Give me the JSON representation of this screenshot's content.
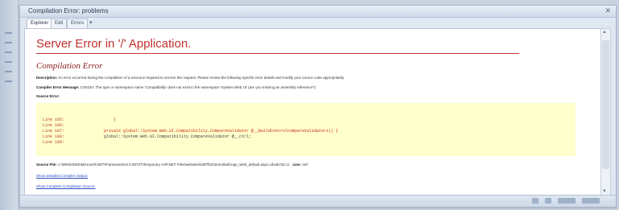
{
  "window": {
    "title": "Compilation Error: problems"
  },
  "tabs": [
    "Explorer",
    "Edit",
    "Errors"
  ],
  "page": {
    "title": "Server Error in '/' Application.",
    "subtitle": "Compilation Error",
    "description_label": "Description:",
    "description_text": "An error occurred during the compilation of a resource required to service this request. Please review the following specific error details and modify your source code appropriately.",
    "compiler_label": "Compiler Error Message:",
    "compiler_text": "CS0234: The type or namespace name 'Compatibility' does not exist in the namespace 'System.Web.UI' (are you missing an assembly reference?)",
    "source_error_label": "Source Error:",
    "code_lines": [
      {
        "num": "Line 185:",
        "text": "}"
      },
      {
        "num": "Line 186:",
        "text": ""
      },
      {
        "num": "Line 187:",
        "text": "private global::System.Web.UI.Compatibility.CompareValidator @__BuildControlcompareValidator1() {"
      },
      {
        "num": "Line 188:",
        "text": "    global::System.Web.UI.Compatibility.CompareValidator @__ctrl;"
      },
      {
        "num": "Line 189:",
        "text": ""
      }
    ],
    "source_file_label": "Source File:",
    "source_file_text": "c:\\WINDOWS\\Microsoft.NET\\Framework\\v2.0.50727\\Temporary ASP.NET Files\\website\\9c8f7f62\\2e4c9bab\\App_Web_default.aspx.cdcab7d2.cs",
    "line_label": "Line:",
    "line_value": "187",
    "link_detailed": "Show Detailed Compiler Output:",
    "link_complete": "Show Complete Compilation Source:"
  }
}
